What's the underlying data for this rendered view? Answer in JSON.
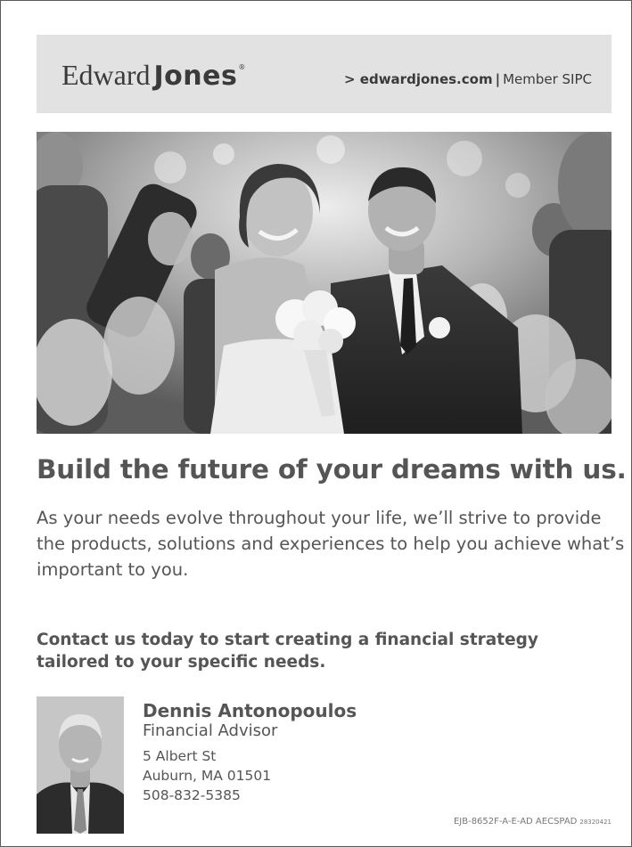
{
  "header": {
    "logo_part1": "Edward",
    "logo_part2": "Jones",
    "logo_reg": "®",
    "site_link": "> edwardjones.com",
    "separator": "|",
    "member": "Member SIPC"
  },
  "photo": {
    "subject": "wedding-couple-photo"
  },
  "headline": "Build the future of your dreams with us.",
  "body_text": "As your needs evolve throughout your life, we’ll strive to provide the products, solutions and experiences to help you achieve what’s important to you.",
  "cta": "Contact us today to start creating a financial strategy tailored to your specific needs.",
  "advisor": {
    "name": "Dennis Antonopoulos",
    "title": "Financial Advisor",
    "address_line1": "5 Albert St",
    "address_line2": "Auburn, MA 01501",
    "phone": "508-832-5385"
  },
  "footer": {
    "code": "EJB-8652F-A-E-AD  AECSPAD",
    "code_small": "28320421"
  },
  "colors": {
    "header_bg": "#e2e2e2",
    "text": "#555555",
    "border": "#5a5a5a"
  }
}
